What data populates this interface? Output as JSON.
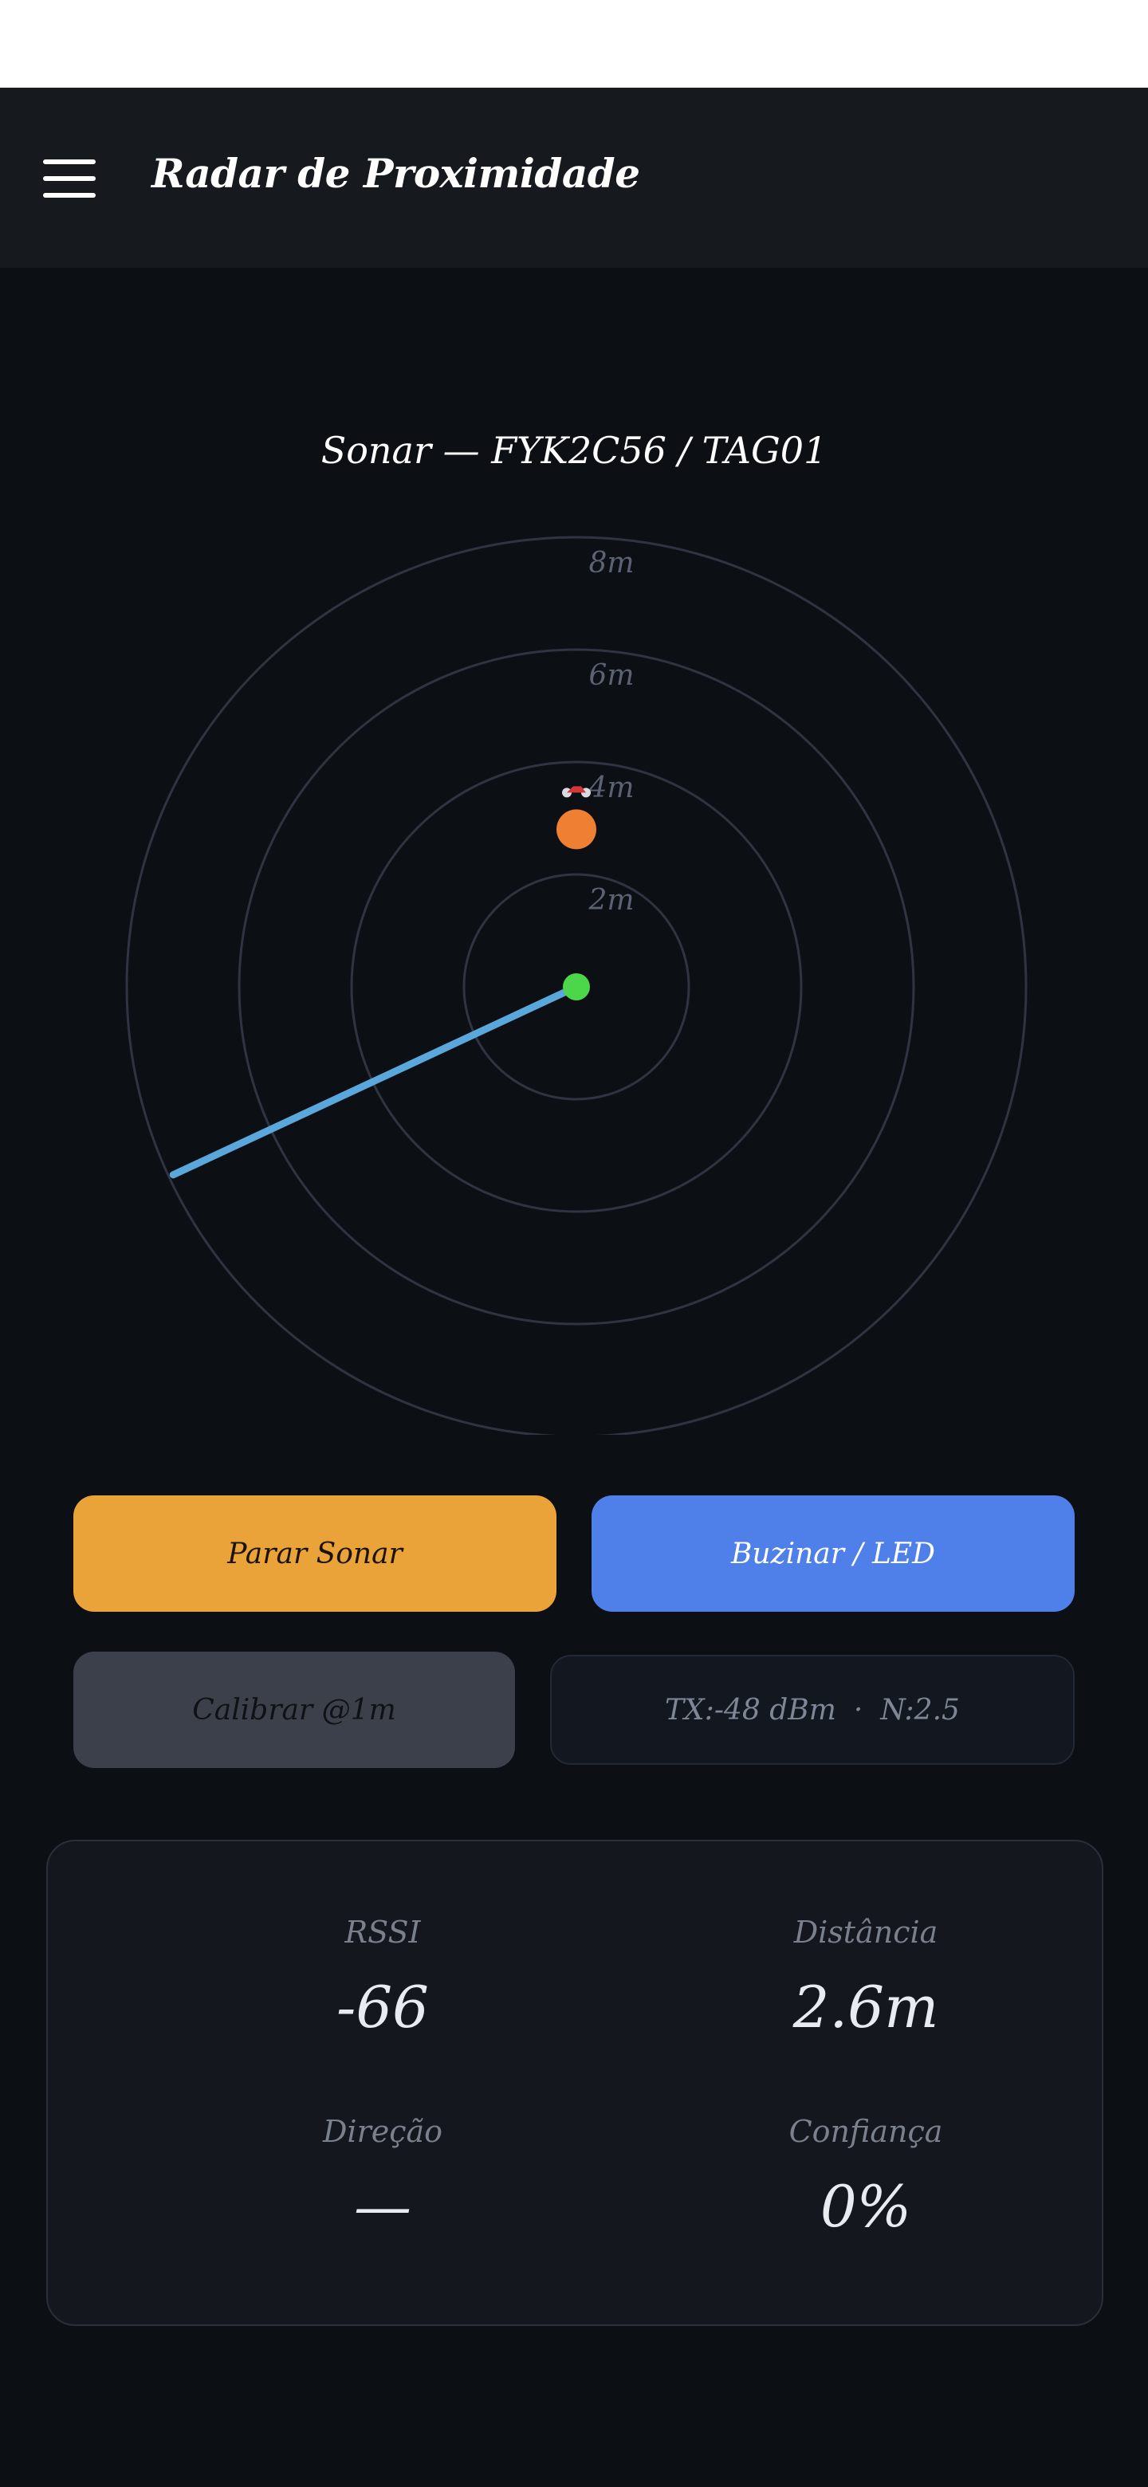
{
  "header": {
    "title": "Radar de Proximidade",
    "menu_icon": "hamburger-menu-icon"
  },
  "sonar": {
    "title": "Sonar — FYK2C56 / TAG01",
    "ring_labels": [
      "2m",
      "4m",
      "6m",
      "8m"
    ],
    "target_distance_m": 2.6,
    "target_bearing_deg": 0,
    "sweep_bearing_deg": 245,
    "target_icon": "motorcycle-icon",
    "colors": {
      "ring": "#2f3440",
      "ring_label": "#5b6271",
      "center": "#4cd64a",
      "target": "#ef7f32",
      "sweep": "#5aa7dc"
    }
  },
  "controls": {
    "stop_label": "Parar Sonar",
    "horn_label": "Buzinar / LED",
    "calibrate_label": "Calibrar @1m",
    "tx_label": "TX:-48 dBm",
    "separator": "·",
    "n_label": "N:2.5"
  },
  "stats": {
    "rssi_label": "RSSI",
    "rssi_value": "-66",
    "distance_label": "Distância",
    "distance_value": "2.6m",
    "direction_label": "Direção",
    "direction_value": "—",
    "confidence_label": "Confiança",
    "confidence_value": "0%"
  }
}
